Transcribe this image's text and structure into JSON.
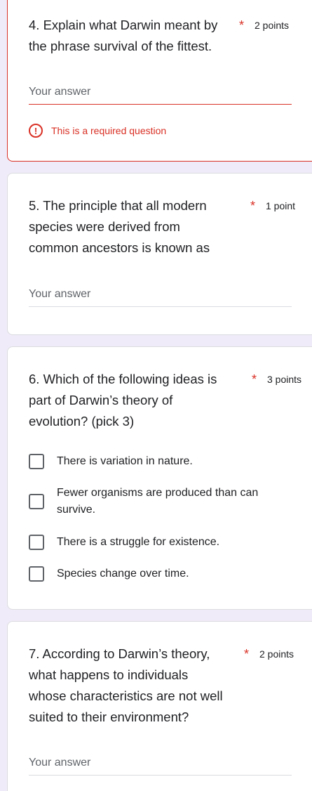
{
  "q4": {
    "title": "4. Explain what Darwin meant by the phrase survival of the fittest.",
    "required": "*",
    "points": "2 points",
    "answer_placeholder": "Your answer",
    "error_icon": "!",
    "error_text": "This is a required question"
  },
  "q5": {
    "title": "5. The principle that all modern species were derived from common ancestors is known as",
    "required": "*",
    "points": "1 point",
    "answer_placeholder": "Your answer"
  },
  "q6": {
    "title": "6. Which of the following ideas is part of Darwin’s theory of evolution? (pick 3)",
    "required": "*",
    "points": "3 points",
    "options": [
      "There is variation in nature.",
      "Fewer organisms are produced than can survive.",
      "There is a struggle for existence.",
      "Species change over time."
    ]
  },
  "q7": {
    "title": "7. According to Darwin’s theory, what happens to individuals whose characteristics are not well suited to their environment?",
    "required": "*",
    "points": "2 points",
    "answer_placeholder": "Your answer"
  },
  "colors": {
    "background": "#f0ebf8",
    "error": "#d93025",
    "text": "#202124",
    "muted": "#5f6368"
  },
  "icons": {
    "error": "error-icon",
    "checkbox": "checkbox-icon"
  }
}
